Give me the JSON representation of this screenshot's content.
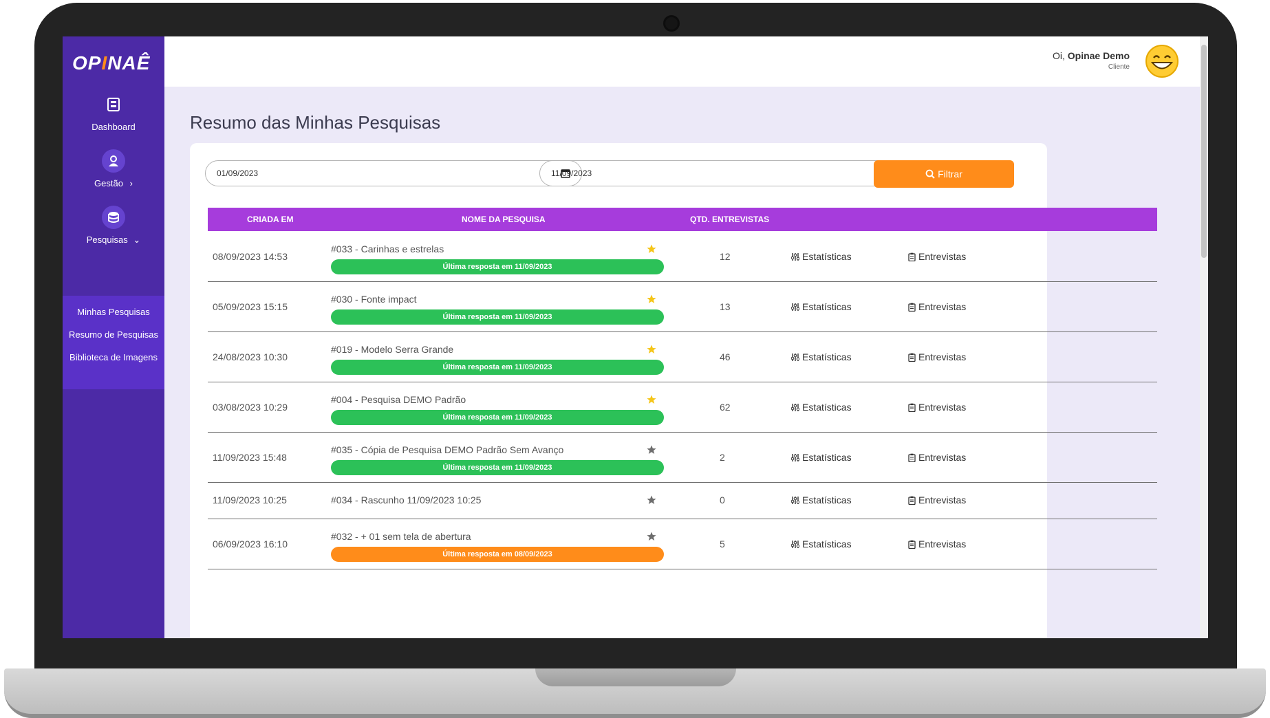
{
  "brand": {
    "logo_left": "OP",
    "logo_mid": "I",
    "logo_right": "NAÊ"
  },
  "sidebar": {
    "items": [
      {
        "label": "Dashboard",
        "icon": "dashboard-icon"
      },
      {
        "label": "Gestão",
        "icon": "user-icon"
      },
      {
        "label": "Pesquisas",
        "icon": "database-icon"
      }
    ],
    "submenu": [
      "Minhas Pesquisas",
      "Resumo de Pesquisas",
      "Biblioteca de Imagens"
    ]
  },
  "header": {
    "greeting": "Oi,",
    "user_name": "Opinae Demo",
    "role": "Cliente"
  },
  "main": {
    "title": "Resumo das Minhas Pesquisas",
    "filter": {
      "date_from": "01/09/2023",
      "date_to": "11/09/2023",
      "button_label": "Filtrar"
    },
    "table": {
      "headers": [
        "CRIADA EM",
        "NOME DA PESQUISA",
        "QTD. ENTREVISTAS"
      ],
      "stats_label": "Estatísticas",
      "interviews_label": "Entrevistas",
      "rows": [
        {
          "created": "08/09/2023 14:53",
          "name": "#033 - Carinhas e estrelas",
          "favorite": true,
          "count": "12",
          "last": "Última resposta em 11/09/2023",
          "last_color": "#2cc158"
        },
        {
          "created": "05/09/2023 15:15",
          "name": "#030 - Fonte impact",
          "favorite": true,
          "count": "13",
          "last": "Última resposta em 11/09/2023",
          "last_color": "#2cc158"
        },
        {
          "created": "24/08/2023 10:30",
          "name": "#019 - Modelo Serra Grande",
          "favorite": true,
          "count": "46",
          "last": "Última resposta em 11/09/2023",
          "last_color": "#2cc158"
        },
        {
          "created": "03/08/2023 10:29",
          "name": "#004 - Pesquisa DEMO Padrão",
          "favorite": true,
          "count": "62",
          "last": "Última resposta em 11/09/2023",
          "last_color": "#2cc158"
        },
        {
          "created": "11/09/2023 15:48",
          "name": "#035 - Cópia de Pesquisa DEMO Padrão Sem Avanço",
          "favorite": false,
          "count": "2",
          "last": "Última resposta em 11/09/2023",
          "last_color": "#2cc158"
        },
        {
          "created": "11/09/2023 10:25",
          "name": "#034 - Rascunho 11/09/2023 10:25",
          "favorite": false,
          "count": "0",
          "last": "",
          "last_color": ""
        },
        {
          "created": "06/09/2023 16:10",
          "name": "#032 - + 01 sem tela de abertura",
          "favorite": false,
          "count": "5",
          "last": "Última resposta em 08/09/2023",
          "last_color": "#ff8c1a"
        }
      ]
    }
  },
  "colors": {
    "sidebar": "#4c2aa6",
    "header_row": "#a63cdc",
    "accent": "#ff8c1a",
    "success": "#2cc158",
    "star_on": "#f5c518",
    "star_off": "#6d6d6d"
  }
}
